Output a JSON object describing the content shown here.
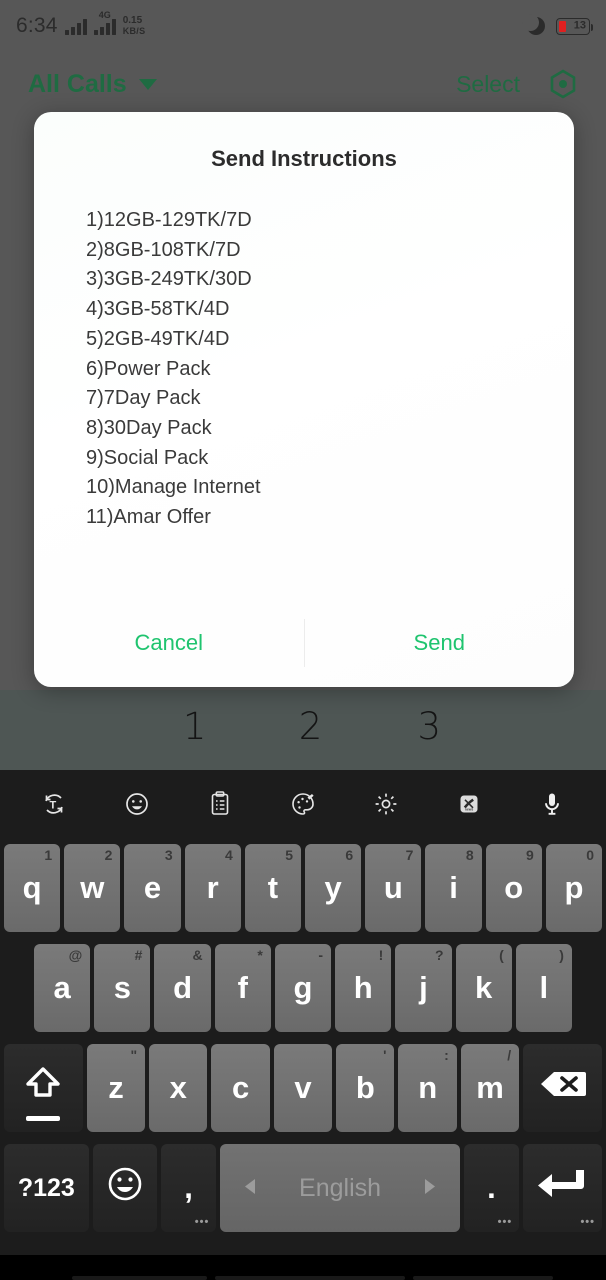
{
  "status_bar": {
    "time": "6:34",
    "network_type": "4G",
    "data_rate": "0.15",
    "data_rate_unit": "KB/S",
    "dnd_icon": "moon-icon",
    "battery_level": "13",
    "battery_color": "#e02020"
  },
  "app_header": {
    "filter_label": "All Calls",
    "caret_icon": "chevron-down-icon",
    "select_label": "Select",
    "settings_icon": "hexagon-target-icon",
    "accent_color": "#1f6b42"
  },
  "background_list_numbers": [
    "",
    "1",
    "2",
    "3",
    ""
  ],
  "dialog": {
    "title": "Send Instructions",
    "items": [
      "1)12GB-129TK/7D",
      "2)8GB-108TK/7D",
      "3)3GB-249TK/30D",
      "4)3GB-58TK/4D",
      "5)2GB-49TK/4D",
      "6)Power Pack",
      "7)7Day Pack",
      "8)30Day Pack",
      "9)Social Pack",
      "10)Manage Internet",
      "11)Amar Offer"
    ],
    "input_value": "",
    "input_placeholder": "",
    "input_underline_color": "#4ec98c",
    "cancel_label": "Cancel",
    "send_label": "Send",
    "action_color": "#1fc46f"
  },
  "keyboard": {
    "toolbar": [
      {
        "icon": "translate-icon"
      },
      {
        "icon": "emoji-icon"
      },
      {
        "icon": "clipboard-icon"
      },
      {
        "icon": "theme-palette-icon"
      },
      {
        "icon": "gear-icon"
      },
      {
        "icon": "news-icon"
      },
      {
        "icon": "microphone-icon"
      }
    ],
    "row1": [
      {
        "key": "q",
        "alt": "1"
      },
      {
        "key": "w",
        "alt": "2"
      },
      {
        "key": "e",
        "alt": "3"
      },
      {
        "key": "r",
        "alt": "4"
      },
      {
        "key": "t",
        "alt": "5"
      },
      {
        "key": "y",
        "alt": "6"
      },
      {
        "key": "u",
        "alt": "7"
      },
      {
        "key": "i",
        "alt": "8"
      },
      {
        "key": "o",
        "alt": "9"
      },
      {
        "key": "p",
        "alt": "0"
      }
    ],
    "row2": [
      {
        "key": "a",
        "alt": "@"
      },
      {
        "key": "s",
        "alt": "#"
      },
      {
        "key": "d",
        "alt": "&"
      },
      {
        "key": "f",
        "alt": "*"
      },
      {
        "key": "g",
        "alt": "-"
      },
      {
        "key": "h",
        "alt": "!"
      },
      {
        "key": "j",
        "alt": "?"
      },
      {
        "key": "k",
        "alt": "("
      },
      {
        "key": "l",
        "alt": ")"
      }
    ],
    "row3": [
      {
        "key": "z",
        "alt": "\""
      },
      {
        "key": "x",
        "alt": ""
      },
      {
        "key": "c",
        "alt": ""
      },
      {
        "key": "v",
        "alt": ""
      },
      {
        "key": "b",
        "alt": "'"
      },
      {
        "key": "n",
        "alt": ":"
      },
      {
        "key": "m",
        "alt": "/"
      }
    ],
    "shift_icon": "shift-up-arrow-icon",
    "backspace_icon": "backspace-icon",
    "symbols_label": "?123",
    "emoji_icon": "emoji-smiley-icon",
    "comma_label": ",",
    "space_label": "English",
    "space_prev_icon": "triangle-left-icon",
    "space_next_icon": "triangle-right-icon",
    "period_label": ".",
    "enter_icon": "enter-arrow-icon",
    "long_press_hint": "•••"
  }
}
